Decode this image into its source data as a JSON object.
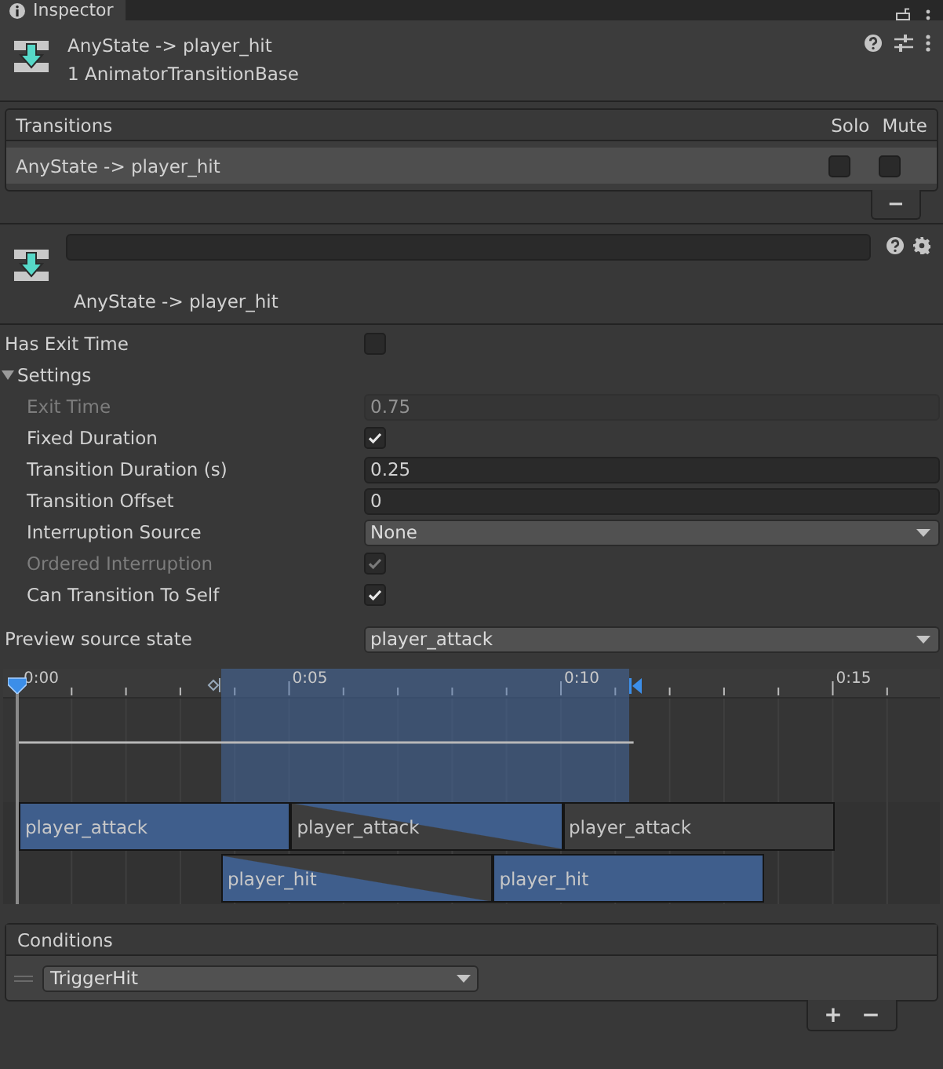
{
  "tab": {
    "title": "Inspector"
  },
  "header": {
    "title": "AnyState -> player_hit",
    "subtitle": "1 AnimatorTransitionBase"
  },
  "transitions": {
    "title": "Transitions",
    "columns": [
      "Solo",
      "Mute"
    ],
    "rows": [
      {
        "name": "AnyState -> player_hit",
        "solo": false,
        "mute": false,
        "selected": true
      }
    ],
    "buttons": [
      "−"
    ]
  },
  "transition": {
    "label": "AnyState -> player_hit"
  },
  "properties": [
    {
      "kind": "checkbox",
      "label": "Has Exit Time",
      "checked": false,
      "disabled": false
    },
    {
      "kind": "foldout",
      "label": "Settings",
      "expanded": true,
      "children": [
        {
          "kind": "field",
          "label": "Exit Time",
          "value": "0.75",
          "disabled": true
        },
        {
          "kind": "checkbox",
          "label": "Fixed Duration",
          "checked": true,
          "disabled": false
        },
        {
          "kind": "field",
          "label": "Transition Duration (s)",
          "value": "0.25",
          "disabled": false
        },
        {
          "kind": "field",
          "label": "Transition Offset",
          "value": "0",
          "disabled": false
        },
        {
          "kind": "dropdown",
          "label": "Interruption Source",
          "value": "None",
          "disabled": false
        },
        {
          "kind": "checkbox",
          "label": "Ordered Interruption",
          "checked": true,
          "disabled": true
        },
        {
          "kind": "checkbox",
          "label": "Can Transition To Self",
          "checked": true,
          "disabled": false
        }
      ]
    }
  ],
  "preview": {
    "label": "Preview source state",
    "value": "player_attack"
  },
  "timeline": {
    "ticks": [
      "0:00",
      "0:05",
      "0:10",
      "0:15"
    ],
    "source_clips": [
      "player_attack",
      "player_attack",
      "player_attack"
    ],
    "destination_clips": [
      "player_hit",
      "player_hit"
    ]
  },
  "conditions": {
    "title": "Conditions",
    "rows": [
      {
        "parameter": "TriggerHit"
      }
    ],
    "buttons": [
      "+",
      "−"
    ]
  }
}
